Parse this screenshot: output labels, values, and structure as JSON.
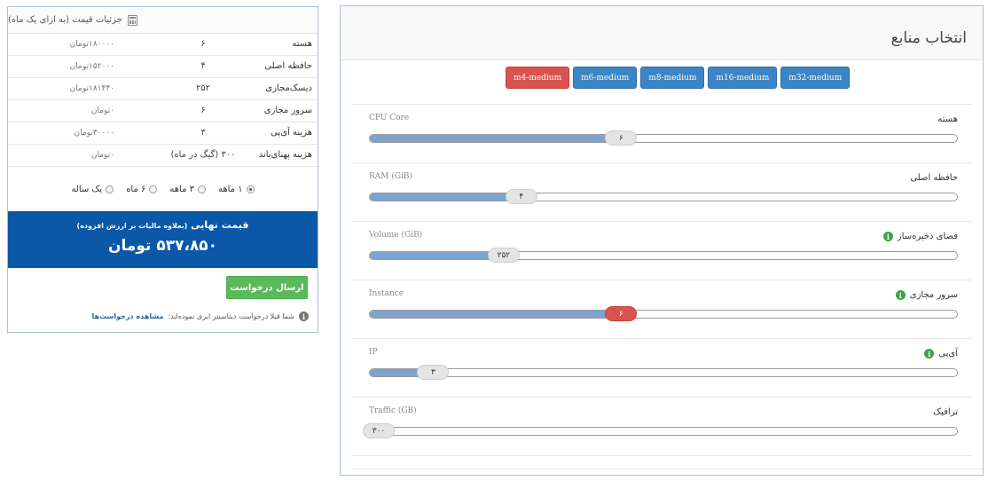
{
  "price_panel": {
    "title": "جزئیات قیمت (به ازای یک ماه)",
    "rows": [
      {
        "label": "هسته",
        "qty": "۶",
        "cost": "۱۸۰۰۰۰تومان"
      },
      {
        "label": "حافظه اصلی",
        "qty": "۴",
        "cost": "۱۵۲۰۰۰تومان"
      },
      {
        "label": "دیسک‌مجازی",
        "qty": "۲۵۲",
        "cost": "۱۸۱۴۴۰تومان"
      },
      {
        "label": "سرور مجازی",
        "qty": "۶",
        "cost": "۰تومان"
      },
      {
        "label": "هزینه آی‌پی",
        "qty": "۳",
        "cost": "۳۰۰۰۰تومان"
      },
      {
        "label": "هزینه پهنای‌باند",
        "qty": "۳۰۰ (گیگ در ماه)",
        "cost": "۰تومان"
      }
    ],
    "periods": [
      {
        "label": "۱ ماهه",
        "checked": true
      },
      {
        "label": "۳ ماهه",
        "checked": false
      },
      {
        "label": "۶ ماه",
        "checked": false
      },
      {
        "label": "یک ساله",
        "checked": false
      }
    ],
    "total_label": "قیمت نهایی",
    "total_note": "(بعلاوه مالیات بر ارزش افزوده)",
    "total_amount": "۵۳۷،۸۵۰ تومان",
    "submit_label": "ارسال درخواست",
    "notice_text": "شما قبلا درخواست دیتاسنتر ابری نموده‌اید:",
    "notice_link": "مشاهده درخواست‌ها"
  },
  "resource_panel": {
    "title": "انتخاب منابع",
    "presets": [
      {
        "label": "m4-medium",
        "active": true
      },
      {
        "label": "m6-medium",
        "active": false
      },
      {
        "label": "m8-medium",
        "active": false
      },
      {
        "label": "m16-medium",
        "active": false
      },
      {
        "label": "m32-medium",
        "active": false
      }
    ],
    "sliders": [
      {
        "label": "هسته",
        "sub": "CPU Core",
        "value": "۶",
        "fraction": 0.44,
        "info": false,
        "red": false
      },
      {
        "label": "حافظه اصلی",
        "sub": "RAM (GiB)",
        "value": "۴",
        "fraction": 0.27,
        "info": false,
        "red": false
      },
      {
        "label": "فضای ذخیره‌ساز",
        "sub": "Volume (GiB)",
        "value": "۲۵۲",
        "fraction": 0.24,
        "info": true,
        "red": false
      },
      {
        "label": "سرور مجازی",
        "sub": "Instance",
        "value": "۶",
        "fraction": 0.44,
        "info": true,
        "red": true
      },
      {
        "label": "آی‌پی",
        "sub": "IP",
        "value": "۳",
        "fraction": 0.12,
        "info": true,
        "red": false
      },
      {
        "label": "ترافیک",
        "sub": "Traffic (GB)",
        "value": "۳۰۰",
        "fraction": 0.0,
        "info": false,
        "red": false
      }
    ]
  },
  "icons": {
    "calculator": "calculator-icon",
    "info": "info-icon"
  },
  "colors": {
    "primary_blue": "#0b57a8",
    "preset_blue": "#3c85c4",
    "active_red": "#d9534f",
    "success_green": "#5cb85c",
    "slider_fill": "#7da3cf"
  }
}
